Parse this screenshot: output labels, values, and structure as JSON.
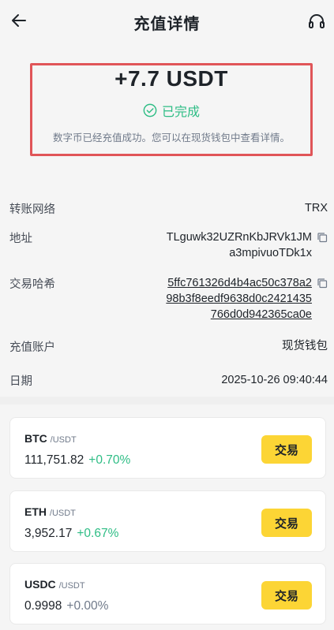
{
  "header": {
    "title": "充值详情",
    "back_icon": "arrow-left-icon",
    "support_icon": "headset-icon"
  },
  "summary": {
    "amount": "+7.7 USDT",
    "status": "已完成",
    "status_color": "#2ebd85",
    "note": "数字币已经充值成功。您可以在现货钱包中查看详情。"
  },
  "details": {
    "network": {
      "label": "转账网络",
      "value": "TRX"
    },
    "address": {
      "label": "地址",
      "value": "TLguwk32UZRnKbJRVk1JMa3mpivuoTDk1x"
    },
    "hash": {
      "label": "交易哈希",
      "value": "5ffc761326d4b4ac50c378a298b3f8eedf9638d0c2421435766d0d942365ca0e"
    },
    "account": {
      "label": "充值账户",
      "value": "现货钱包"
    },
    "date": {
      "label": "日期",
      "value": "2025-10-26 09:40:44"
    }
  },
  "markets": [
    {
      "symbol": "BTC",
      "quote": "/USDT",
      "price": "111,751.82",
      "change": "+0.70%",
      "change_color": "#2ebd85",
      "button": "交易"
    },
    {
      "symbol": "ETH",
      "quote": "/USDT",
      "price": "3,952.17",
      "change": "+0.67%",
      "change_color": "#2ebd85",
      "button": "交易"
    },
    {
      "symbol": "USDC",
      "quote": "/USDT",
      "price": "0.9998",
      "change": "+0.00%",
      "change_color": "#707a8a",
      "button": "交易"
    }
  ],
  "colors": {
    "accent": "#fcd535",
    "highlight_border": "#e05558"
  }
}
